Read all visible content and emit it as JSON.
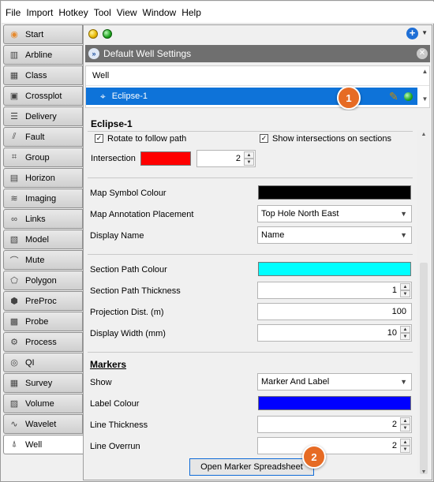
{
  "menu": [
    "File",
    "Import",
    "Hotkey",
    "Tool",
    "View",
    "Window",
    "Help"
  ],
  "nav": [
    {
      "label": "Start",
      "icon": "start-icon"
    },
    {
      "label": "Arbline",
      "icon": "arbline-icon"
    },
    {
      "label": "Class",
      "icon": "class-icon"
    },
    {
      "label": "Crossplot",
      "icon": "crossplot-icon"
    },
    {
      "label": "Delivery",
      "icon": "delivery-icon"
    },
    {
      "label": "Fault",
      "icon": "fault-icon"
    },
    {
      "label": "Group",
      "icon": "group-icon"
    },
    {
      "label": "Horizon",
      "icon": "horizon-icon"
    },
    {
      "label": "Imaging",
      "icon": "imaging-icon"
    },
    {
      "label": "Links",
      "icon": "links-icon"
    },
    {
      "label": "Model",
      "icon": "model-icon"
    },
    {
      "label": "Mute",
      "icon": "mute-icon"
    },
    {
      "label": "Polygon",
      "icon": "polygon-icon"
    },
    {
      "label": "PreProc",
      "icon": "preproc-icon"
    },
    {
      "label": "Probe",
      "icon": "probe-icon"
    },
    {
      "label": "Process",
      "icon": "process-icon"
    },
    {
      "label": "QI",
      "icon": "qi-icon"
    },
    {
      "label": "Survey",
      "icon": "survey-icon"
    },
    {
      "label": "Volume",
      "icon": "volume-icon"
    },
    {
      "label": "Wavelet",
      "icon": "wavelet-icon"
    },
    {
      "label": "Well",
      "icon": "well-icon",
      "active": true
    }
  ],
  "panel": {
    "settings_title": "Default Well Settings",
    "list_header": "Well",
    "selected_well": "Eclipse-1",
    "badge1": "1",
    "badge2": "2"
  },
  "details": {
    "title": "Eclipse-1",
    "rotate_label": "Rotate to follow path",
    "rotate_checked": true,
    "show_intersections_label": "Show intersections on sections",
    "show_intersections_checked": true,
    "intersection_label": "Intersection",
    "intersection_color": "#ff0000",
    "intersection_value": "2",
    "map_symbol_colour_label": "Map Symbol Colour",
    "map_symbol_colour": "#000000",
    "map_annotation_label": "Map Annotation Placement",
    "map_annotation_value": "Top Hole North East",
    "display_name_label": "Display Name",
    "display_name_value": "Name",
    "section_path_colour_label": "Section Path Colour",
    "section_path_colour": "#00ffff",
    "section_path_thickness_label": "Section Path Thickness",
    "section_path_thickness_value": "1",
    "projection_dist_label": "Projection Dist. (m)",
    "projection_dist_value": "100",
    "display_width_label": "Display Width (mm)",
    "display_width_value": "10",
    "markers_heading": "Markers",
    "show_label": "Show",
    "show_value": "Marker And Label",
    "label_colour_label": "Label Colour",
    "label_colour": "#0000ff",
    "line_thickness_label": "Line Thickness",
    "line_thickness_value": "2",
    "line_overrun_label": "Line Overrun",
    "line_overrun_value": "2",
    "spreadsheet_button": "Open Marker Spreadsheet"
  }
}
